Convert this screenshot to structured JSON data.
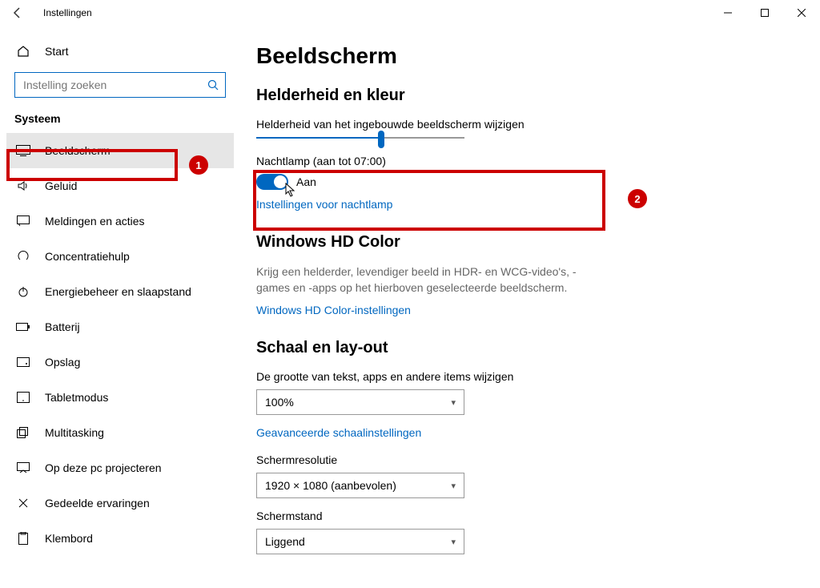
{
  "window": {
    "title": "Instellingen"
  },
  "sidebar": {
    "home": "Start",
    "search_placeholder": "Instelling zoeken",
    "category": "Systeem",
    "items": [
      {
        "label": "Beeldscherm"
      },
      {
        "label": "Geluid"
      },
      {
        "label": "Meldingen en acties"
      },
      {
        "label": "Concentratiehulp"
      },
      {
        "label": "Energiebeheer en slaapstand"
      },
      {
        "label": "Batterij"
      },
      {
        "label": "Opslag"
      },
      {
        "label": "Tabletmodus"
      },
      {
        "label": "Multitasking"
      },
      {
        "label": "Op deze pc projecteren"
      },
      {
        "label": "Gedeelde ervaringen"
      },
      {
        "label": "Klembord"
      }
    ]
  },
  "main": {
    "h1": "Beeldscherm",
    "brightness": {
      "heading": "Helderheid en kleur",
      "slider_label": "Helderheid van het ingebouwde beeldscherm wijzigen",
      "nightlight_label": "Nachtlamp (aan tot 07:00)",
      "toggle_state": "Aan",
      "nightlight_link": "Instellingen voor nachtlamp"
    },
    "hdcolor": {
      "heading": "Windows HD Color",
      "desc": "Krijg een helderder, levendiger beeld in HDR- en WCG-video's, -games en -apps op het hierboven geselecteerde beeldscherm.",
      "link": "Windows HD Color-instellingen"
    },
    "scale": {
      "heading": "Schaal en lay-out",
      "size_label": "De grootte van tekst, apps en andere items wijzigen",
      "size_value": "100%",
      "advanced_link": "Geavanceerde schaalinstellingen",
      "resolution_label": "Schermresolutie",
      "resolution_value": "1920 × 1080 (aanbevolen)",
      "orientation_label": "Schermstand",
      "orientation_value": "Liggend"
    }
  },
  "annotations": {
    "one": "1",
    "two": "2"
  }
}
